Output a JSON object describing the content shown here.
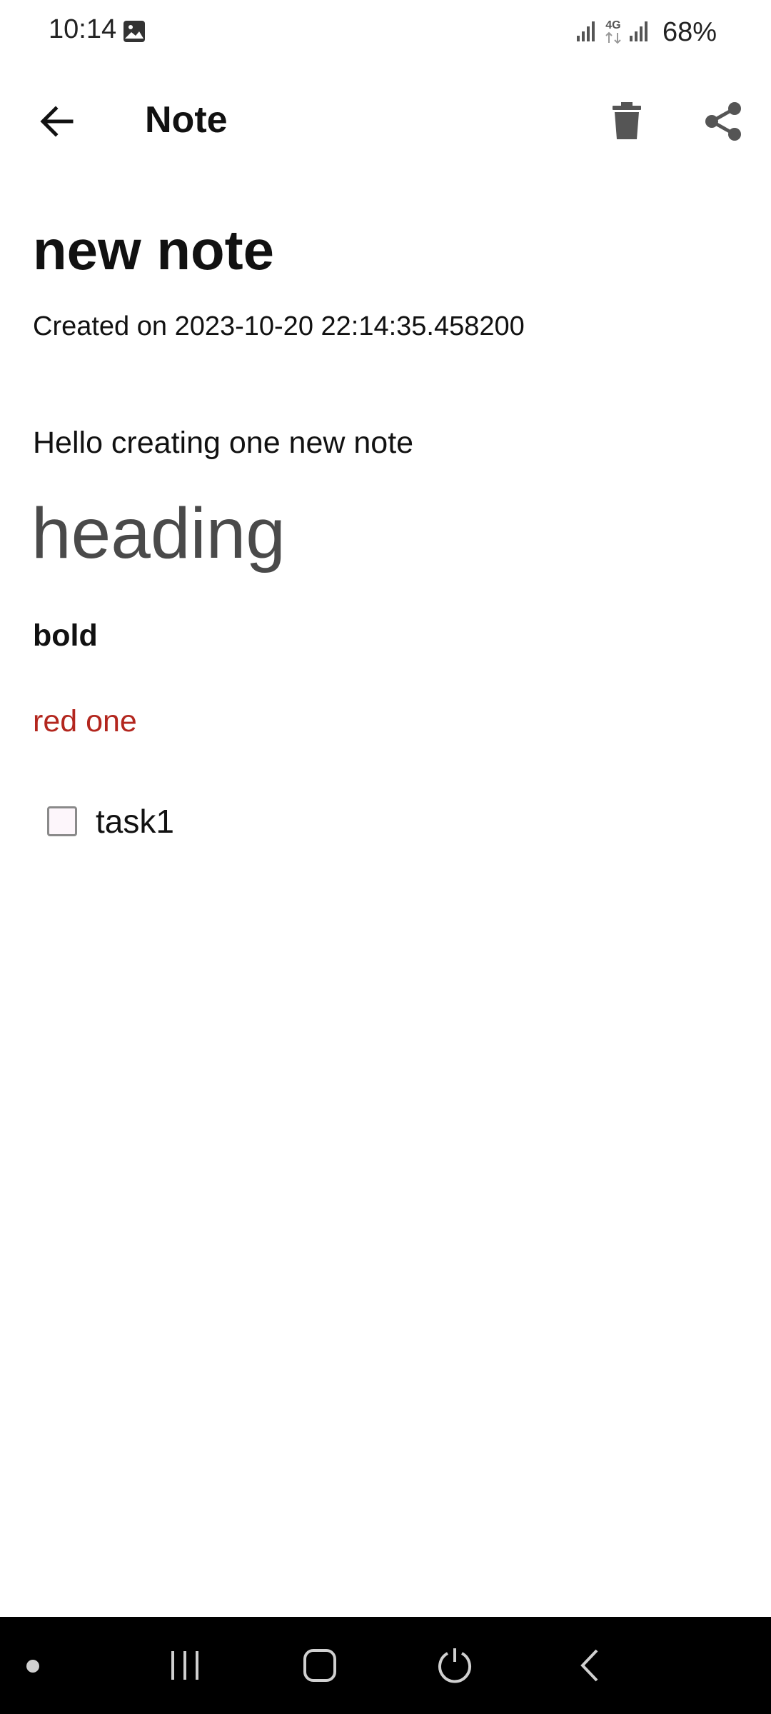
{
  "status_bar": {
    "time": "10:14",
    "network": "4G",
    "battery": "68%",
    "icons": [
      "image-icon",
      "signal-icon",
      "data-arrows-icon",
      "signal-icon"
    ]
  },
  "app_bar": {
    "title": "Note",
    "back_icon": "arrow-left-icon",
    "delete_icon": "trash-icon",
    "share_icon": "share-icon"
  },
  "note": {
    "title": "new note",
    "created": "Created on 2023-10-20 22:14:35.458200",
    "paragraph": "Hello creating one new note",
    "heading": "heading",
    "bold_text": "bold",
    "red_text": "red one",
    "red_color": "#b3261e",
    "tasks": [
      {
        "label": "task1",
        "checked": false
      }
    ]
  },
  "nav_bar": {
    "icons": [
      "dot-icon",
      "recent-apps-icon",
      "home-icon",
      "power-icon",
      "back-icon"
    ]
  }
}
